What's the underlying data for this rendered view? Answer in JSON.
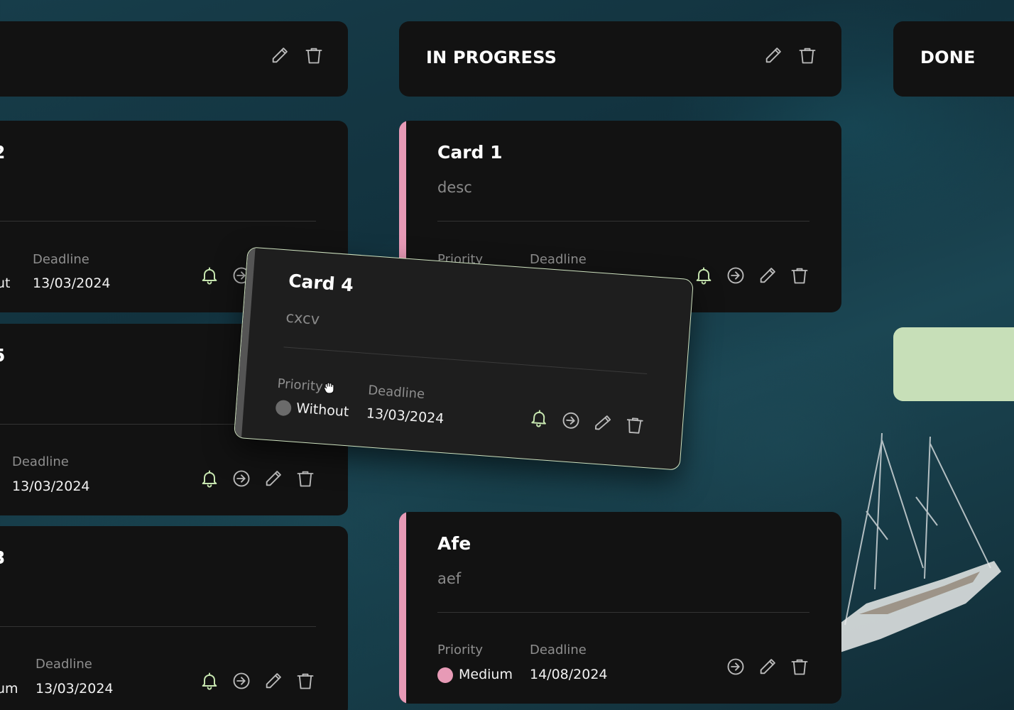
{
  "colors": {
    "panel": "#121212",
    "accent_pink": "#e79ab6",
    "bell_green": "#c7e6b0",
    "priority_without": "#6b6b6b",
    "priority_medium": "#e79ab6",
    "drop_placeholder": "#c7dfb8"
  },
  "columns": [
    {
      "title": "",
      "actions": [
        "edit-icon",
        "trash-icon"
      ]
    },
    {
      "title": "IN PROGRESS",
      "actions": [
        "edit-icon",
        "trash-icon"
      ]
    },
    {
      "title": "DONE"
    }
  ],
  "left_cards": [
    {
      "title": "2",
      "priority_value": "ut",
      "deadline_label": "Deadline",
      "deadline": "13/03/2024"
    },
    {
      "title": "5",
      "deadline_label": "Deadline",
      "deadline": "13/03/2024"
    },
    {
      "title": "3",
      "priority_value": "um",
      "deadline_label": "Deadline",
      "deadline": "13/03/2024"
    }
  ],
  "in_progress_cards": [
    {
      "title": "Card 1",
      "desc": "desc",
      "priority_label": "Priority",
      "deadline_label": "Deadline"
    },
    {
      "title": "Afe",
      "desc": "aef",
      "priority_label": "Priority",
      "priority": "Medium",
      "deadline_label": "Deadline",
      "deadline": "14/08/2024"
    }
  ],
  "dragged_card": {
    "title": "Card 4",
    "desc": "cxcv",
    "priority_label": "Priority",
    "priority": "Without",
    "deadline_label": "Deadline",
    "deadline": "13/03/2024"
  }
}
